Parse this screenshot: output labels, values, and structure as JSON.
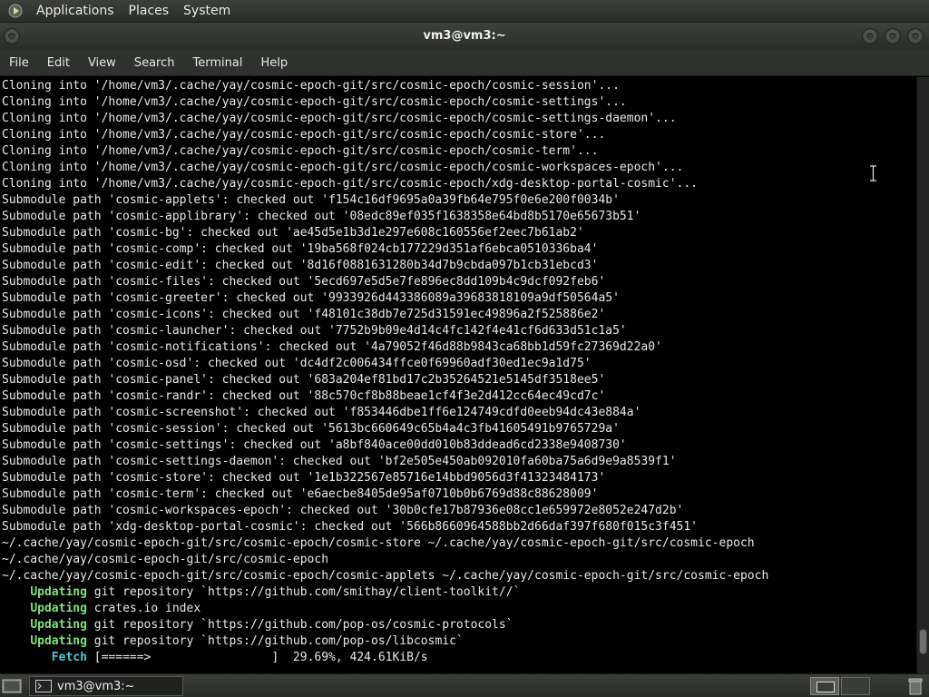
{
  "top_panel": {
    "menus": [
      "Applications",
      "Places",
      "System"
    ]
  },
  "window": {
    "title": "vm3@vm3:~"
  },
  "menubar": {
    "items": [
      "File",
      "Edit",
      "View",
      "Search",
      "Terminal",
      "Help"
    ]
  },
  "terminal": {
    "lines": [
      {
        "text": "Cloning into '/home/vm3/.cache/yay/cosmic-epoch-git/src/cosmic-epoch/cosmic-session'..."
      },
      {
        "text": "Cloning into '/home/vm3/.cache/yay/cosmic-epoch-git/src/cosmic-epoch/cosmic-settings'..."
      },
      {
        "text": "Cloning into '/home/vm3/.cache/yay/cosmic-epoch-git/src/cosmic-epoch/cosmic-settings-daemon'..."
      },
      {
        "text": "Cloning into '/home/vm3/.cache/yay/cosmic-epoch-git/src/cosmic-epoch/cosmic-store'..."
      },
      {
        "text": "Cloning into '/home/vm3/.cache/yay/cosmic-epoch-git/src/cosmic-epoch/cosmic-term'..."
      },
      {
        "text": "Cloning into '/home/vm3/.cache/yay/cosmic-epoch-git/src/cosmic-epoch/cosmic-workspaces-epoch'..."
      },
      {
        "text": "Cloning into '/home/vm3/.cache/yay/cosmic-epoch-git/src/cosmic-epoch/xdg-desktop-portal-cosmic'..."
      },
      {
        "text": "Submodule path 'cosmic-applets': checked out 'f154c16df9695a0a39fb64e795f0e6e200f0034b'"
      },
      {
        "text": "Submodule path 'cosmic-applibrary': checked out '08edc89ef035f1638358e64bd8b5170e65673b51'"
      },
      {
        "text": "Submodule path 'cosmic-bg': checked out 'ae45d5e1b3d1e297e608c160556ef2eec7b61ab2'"
      },
      {
        "text": "Submodule path 'cosmic-comp': checked out '19ba568f024cb177229d351af6ebca0510336ba4'"
      },
      {
        "text": "Submodule path 'cosmic-edit': checked out '8d16f0881631280b34d7b9cbda097b1cb31ebcd3'"
      },
      {
        "text": "Submodule path 'cosmic-files': checked out '5ecd697e5d5e7fe896ec8dd109b4c9dcf092feb6'"
      },
      {
        "text": "Submodule path 'cosmic-greeter': checked out '9933926d443386089a39683818109a9df50564a5'"
      },
      {
        "text": "Submodule path 'cosmic-icons': checked out 'f48101c38db7e725d31591ec49896a2f525886e2'"
      },
      {
        "text": "Submodule path 'cosmic-launcher': checked out '7752b9b09e4d14c4fc142f4e41cf6d633d51c1a5'"
      },
      {
        "text": "Submodule path 'cosmic-notifications': checked out '4a79052f46d88b9843ca68bb1d59fc27369d22a0'"
      },
      {
        "text": "Submodule path 'cosmic-osd': checked out 'dc4df2c006434ffce0f69960adf30ed1ec9a1d75'"
      },
      {
        "text": "Submodule path 'cosmic-panel': checked out '683a204ef81bd17c2b35264521e5145df3518ee5'"
      },
      {
        "text": "Submodule path 'cosmic-randr': checked out '88c570cf8b88beae1cf4f3e2d412cc64ec49cd7c'"
      },
      {
        "text": "Submodule path 'cosmic-screenshot': checked out 'f853446dbe1ff6e124749cdfd0eeb94dc43e884a'"
      },
      {
        "text": "Submodule path 'cosmic-session': checked out '5613bc660649c65b4a4c3fb41605491b9765729a'"
      },
      {
        "text": "Submodule path 'cosmic-settings': checked out 'a8bf840ace00dd010b83ddead6cd2338e9408730'"
      },
      {
        "text": "Submodule path 'cosmic-settings-daemon': checked out 'bf2e505e450ab092010fa60ba75a6d9e9a8539f1'"
      },
      {
        "text": "Submodule path 'cosmic-store': checked out '1e1b322567e85716e14bbd9056d3f41323484173'"
      },
      {
        "text": "Submodule path 'cosmic-term': checked out 'e6aecbe8405de95af0710b0b6769d88c88628009'"
      },
      {
        "text": "Submodule path 'cosmic-workspaces-epoch': checked out '30b0cfe17b87936e08cc1e659972e8052e247d2b'"
      },
      {
        "text": "Submodule path 'xdg-desktop-portal-cosmic': checked out '566b8660964588bb2d66daf397f680f015c3f451'"
      },
      {
        "text": "~/.cache/yay/cosmic-epoch-git/src/cosmic-epoch/cosmic-store ~/.cache/yay/cosmic-epoch-git/src/cosmic-epoch"
      },
      {
        "text": "~/.cache/yay/cosmic-epoch-git/src/cosmic-epoch"
      },
      {
        "text": "~/.cache/yay/cosmic-epoch-git/src/cosmic-epoch/cosmic-applets ~/.cache/yay/cosmic-epoch-git/src/cosmic-epoch"
      },
      {
        "indent": "    ",
        "keyword": "Updating",
        "keyword_color": "green",
        "text": " git repository `https://github.com/smithay/client-toolkit//`"
      },
      {
        "indent": "    ",
        "keyword": "Updating",
        "keyword_color": "green",
        "text": " crates.io index"
      },
      {
        "indent": "    ",
        "keyword": "Updating",
        "keyword_color": "green",
        "text": " git repository `https://github.com/pop-os/cosmic-protocols`"
      },
      {
        "indent": "    ",
        "keyword": "Updating",
        "keyword_color": "green",
        "text": " git repository `https://github.com/pop-os/libcosmic`"
      },
      {
        "indent": "       ",
        "keyword": "Fetch",
        "keyword_color": "cyan",
        "text": " [======>                 ]  29.69%, 424.61KiB/s"
      }
    ],
    "scroll_position": 0.97,
    "scroll_visible_fraction": 0.03
  },
  "taskbar": {
    "window_label": "vm3@vm3:~"
  },
  "colors": {
    "green": "#7fe07a",
    "cyan": "#49c7d8",
    "panel": "#2f312e"
  },
  "icons": {
    "panel_logo": "gnome-foot-icon",
    "text_cursor": "ibeam-cursor-icon",
    "show_desktop": "show-desktop-icon",
    "terminal": "terminal-icon",
    "trash": "trash-icon"
  }
}
